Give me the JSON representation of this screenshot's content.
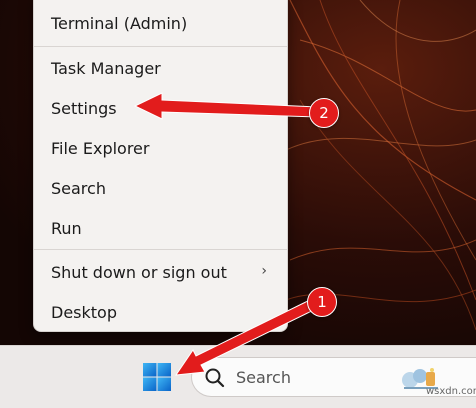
{
  "menu": {
    "items": [
      {
        "label": "Terminal (Admin)"
      },
      {
        "label": "Task Manager"
      },
      {
        "label": "Settings"
      },
      {
        "label": "File Explorer"
      },
      {
        "label": "Search"
      },
      {
        "label": "Run"
      },
      {
        "label": "Shut down or sign out",
        "chevron": "›"
      },
      {
        "label": "Desktop"
      }
    ]
  },
  "taskbar": {
    "start_icon": "windows-logo-icon",
    "search_placeholder": "Search",
    "search_icon": "magnifier-icon"
  },
  "annotations": {
    "badge_1": "1",
    "badge_2": "2",
    "color": "#e21c1c"
  },
  "watermark": "wsxdn.com"
}
